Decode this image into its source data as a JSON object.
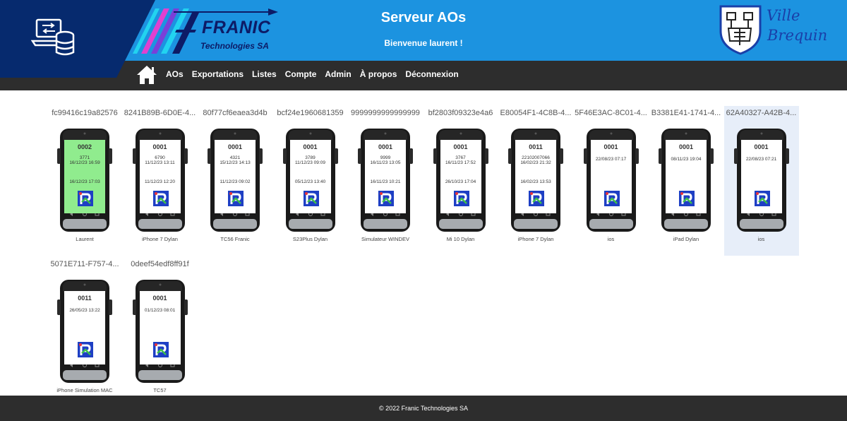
{
  "header": {
    "title": "Serveur AOs",
    "welcome": "Bienvenue laurent !",
    "logo_name": "FRANIC",
    "logo_sub": "Technologies SA",
    "logo_letters": "FT",
    "town_line1": "Ville",
    "town_line2": "Brequin",
    "server_icon": "server-laptop-icon",
    "home_icon": "home-icon"
  },
  "nav": {
    "items": [
      "AOs",
      "Exportations",
      "Listes",
      "Compte",
      "Admin",
      "À propos",
      "Déconnexion"
    ]
  },
  "devices": [
    {
      "id": "fc99416c19a82576",
      "code": "0002",
      "line1": "3771",
      "line2": "16/12/23 16:59",
      "line3": "16/12/23 17:03",
      "name": "Laurent",
      "highlight": "green",
      "selected": false
    },
    {
      "id": "8241B89B-6D0E-4...",
      "code": "0001",
      "line1": "6790",
      "line2": "11/12/23 13:11",
      "line3": "11/12/23 12:20",
      "name": "iPhone 7 Dylan",
      "highlight": "",
      "selected": false
    },
    {
      "id": "80f77cf6eaea3d4b",
      "code": "0001",
      "line1": "4321",
      "line2": "15/12/23 14:13",
      "line3": "11/12/23 09:02",
      "name": "TC56 Franic",
      "highlight": "",
      "selected": false
    },
    {
      "id": "bcf24e1960681359",
      "code": "0001",
      "line1": "3789",
      "line2": "11/12/23 09:09",
      "line3": "05/12/23 13:40",
      "name": "S23Plus Dylan",
      "highlight": "",
      "selected": false
    },
    {
      "id": "9999999999999999",
      "code": "0001",
      "line1": "9999",
      "line2": "16/11/23 13:05",
      "line3": "16/11/23 10:21",
      "name": "Simulateur WINDEV",
      "highlight": "",
      "selected": false
    },
    {
      "id": "bf2803f09323e4a6",
      "code": "0001",
      "line1": "3767",
      "line2": "16/11/23 17:52",
      "line3": "26/10/23 17:04",
      "name": "Mi 10 Dylan",
      "highlight": "",
      "selected": false
    },
    {
      "id": "E80054F1-4C8B-4...",
      "code": "0011",
      "line1": "22102007066",
      "line2": "16/02/23 21:32",
      "line3": "16/02/23 13:53",
      "name": "iPhone 7 Dylan",
      "highlight": "",
      "selected": false
    },
    {
      "id": "5F46E3AC-8C01-4...",
      "code": "0001",
      "line1": "",
      "line2": "22/08/23 07:17",
      "line3": "",
      "name": "ios",
      "highlight": "",
      "selected": false
    },
    {
      "id": "B3381E41-1741-4...",
      "code": "0001",
      "line1": "",
      "line2": "08/11/23 19:04",
      "line3": "",
      "name": "iPad Dylan",
      "highlight": "",
      "selected": false
    },
    {
      "id": "62A40327-A42B-4...",
      "code": "0001",
      "line1": "",
      "line2": "22/08/23 07:21",
      "line3": "",
      "name": "ios",
      "highlight": "",
      "selected": true
    },
    {
      "id": "5071E711-F757-4...",
      "code": "0011",
      "line1": "",
      "line2": "26/05/23 13:22",
      "line3": "",
      "name": "iPhone Simulation MAC",
      "highlight": "",
      "selected": false
    },
    {
      "id": "0deef54edf8ff91f",
      "code": "0001",
      "line1": "",
      "line2": "01/12/23 08:01",
      "line3": "",
      "name": "TC57",
      "highlight": "",
      "selected": false
    }
  ],
  "phone": {
    "brand": "ZEBRA",
    "app_icon": "app-logo-icon"
  },
  "footer": {
    "text": "© 2022 Franic Technologies SA"
  },
  "colors": {
    "header_blue": "#1c93e0",
    "header_navy": "#062a6e",
    "nav_dark": "#2d2d2d",
    "highlight_green": "#90ec8e",
    "selected_bg": "#e7eef9"
  }
}
